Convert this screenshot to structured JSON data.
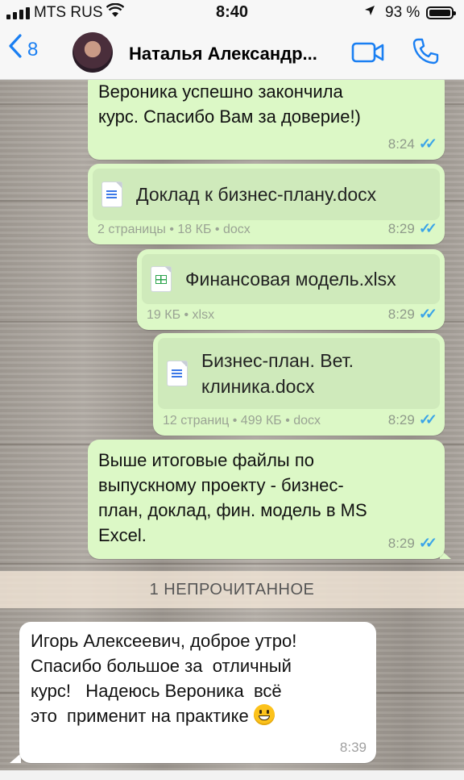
{
  "status_bar": {
    "carrier": "MTS RUS",
    "time": "8:40",
    "battery": "93 %"
  },
  "header": {
    "back_count": "8",
    "contact_name": "Наталья Александр...",
    "video_icon": "video-camera-icon",
    "call_icon": "phone-icon"
  },
  "messages": [
    {
      "text": "Вероника успешно закончила\nкурс. Спасибо Вам за доверие!)",
      "time": "8:24"
    },
    {
      "file_name": "Доклад к бизнес-плану.docx",
      "info": "2 страницы • 18 КБ • docx",
      "time": "8:29",
      "icon": "document-icon"
    },
    {
      "file_name": "Финансовая модель.xlsx",
      "info": "19 КБ • xlsx",
      "time": "8:29",
      "icon": "spreadsheet-icon"
    },
    {
      "file_name": "Бизнес-план. Вет.\nклиника.docx",
      "info": "12 страниц • 499 КБ • docx",
      "time": "8:29",
      "icon": "document-icon"
    },
    {
      "text": "Выше итоговые файлы по\nвыпускному проекту - бизнес-\nплан, доклад, фин. модель в MS\nExcel.",
      "time": "8:29"
    }
  ],
  "unread_label": "1 НЕПРОЧИТАННОЕ",
  "incoming": {
    "text": "Игорь Алексеевич, доброе утро!\nСпасибо большое за  отличный\nкурс!   Надеюсь Вероника  всё\nэто  применит на практике ",
    "emoji": "grinning-face",
    "time": "8:39"
  },
  "colors": {
    "outgoing_bubble": "#dcf8c6",
    "incoming_bubble": "#ffffff",
    "accent": "#1a7ff2",
    "read_ticks": "#3aa4e8"
  }
}
